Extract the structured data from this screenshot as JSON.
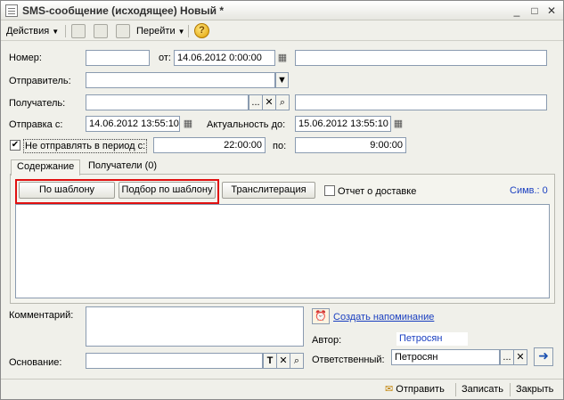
{
  "window": {
    "title": "SMS-сообщение (исходящее) Новый *",
    "controls": [
      "_",
      "□",
      "✕"
    ]
  },
  "toolbar": {
    "actions_label": "Действия",
    "goto_label": "Перейти",
    "help_glyph": "?"
  },
  "form": {
    "number_label": "Номер:",
    "number_value": "",
    "from_label": "от:",
    "date_value": "14.06.2012  0:00:00",
    "sender_label": "Отправитель:",
    "sender_value": "",
    "recipient_label": "Получатель:",
    "recipient_value": "",
    "send_from_label": "Отправка с:",
    "send_from_value": "14.06.2012 13:55:10",
    "actual_until_label": "Актуальность до:",
    "actual_until_value": "15.06.2012 13:55:10",
    "no_send_label": "Не отправлять в период с:",
    "no_send_checked": true,
    "period_from_value": "22:00:00",
    "period_to_label": "по:",
    "period_to_value": "9:00:00"
  },
  "tabs": [
    {
      "label": "Содержание",
      "active": true
    },
    {
      "label": "Получатели  (0)",
      "active": false
    }
  ],
  "content": {
    "by_template_button": "По шаблону",
    "pick_template_button": "Подбор по шаблону",
    "transliteration_button": "Транслитерация",
    "delivery_report_label": "Отчет о доставке",
    "delivery_report_checked": false,
    "symbols_label": "Симв.: 0",
    "message_text": ""
  },
  "footer_form": {
    "comment_label": "Комментарий:",
    "comment_value": "",
    "create_reminder_link": "Создать напоминание",
    "author_label": "Автор:",
    "author_value": "Петросян",
    "basis_label": "Основание:",
    "basis_value": "",
    "responsible_label": "Ответственный:",
    "responsible_value": "Петросян"
  },
  "bottom_bar": {
    "send_label": "Отправить",
    "save_label": "Записать",
    "close_label": "Закрыть"
  },
  "colors": {
    "highlight_box": "#e01010",
    "link": "#1a3fc0",
    "window_bg": "#f0f0ea"
  }
}
